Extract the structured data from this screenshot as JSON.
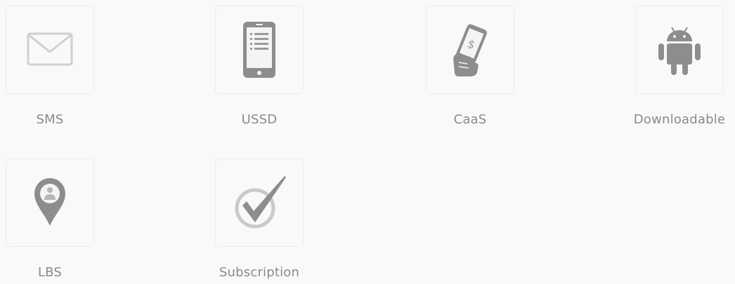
{
  "tiles": [
    {
      "label": "SMS",
      "icon": "envelope-icon"
    },
    {
      "label": "USSD",
      "icon": "mobile-phone-icon"
    },
    {
      "label": "CaaS",
      "icon": "hand-holding-phone-dollar-icon"
    },
    {
      "label": "Downloadable",
      "icon": "android-icon"
    },
    {
      "label": "LBS",
      "icon": "location-pin-icon"
    },
    {
      "label": "Subscription",
      "icon": "checkmark-icon"
    }
  ],
  "colors": {
    "background": "#f9f9fa",
    "tile_border": "#ececee",
    "icon": "#8d8d8d",
    "label": "#8a8a8a"
  }
}
